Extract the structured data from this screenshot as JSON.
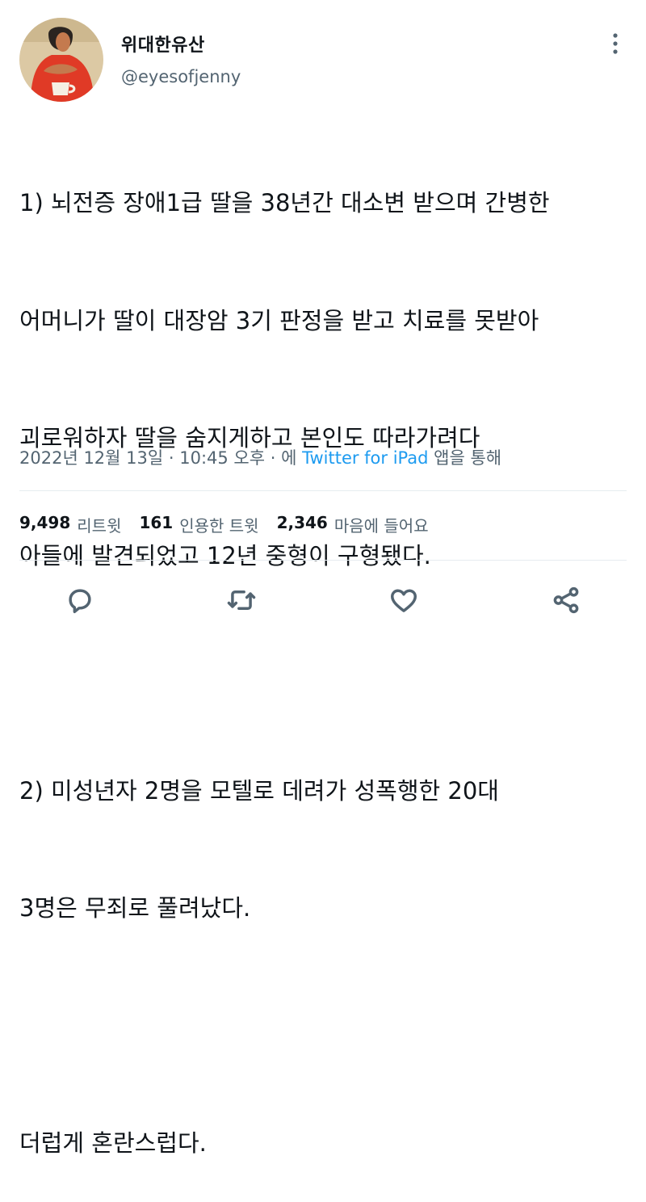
{
  "author": {
    "display_name": "위대한유산",
    "handle": "@eyesofjenny",
    "avatar_icon": "profile-avatar-painting"
  },
  "tweet": {
    "lines": [
      "1) 뇌전증 장애1급 딸을 38년간 대소변 받으며 간병한",
      "어머니가 딸이 대장암 3기 판정을 받고 치료를 못받아",
      "괴로워하자 딸을 숨지게하고 본인도 따라가려다",
      "아들에 발견되었고 12년 중형이 구형됐다.",
      "",
      "2) 미성년자 2명을 모텔로 데려가 성폭행한 20대",
      "3명은 무죄로 풀려났다.",
      "",
      "더럽게 혼란스럽다."
    ]
  },
  "meta": {
    "date": "2022년 12월 13일",
    "sep1": " · ",
    "time": "10:45 오후",
    "sep2": " · 에 ",
    "source": "Twitter for iPad",
    "suffix": " 앱을 통해"
  },
  "stats": {
    "retweets_count": "9,498",
    "retweets_label": "리트윗",
    "quotes_count": "161",
    "quotes_label": "인용한 트윗",
    "likes_count": "2,346",
    "likes_label": "마음에 들어요"
  },
  "actions": {
    "reply_icon": "reply-icon",
    "retweet_icon": "retweet-icon",
    "like_icon": "heart-icon",
    "share_icon": "share-icon",
    "icon_color": "#536471"
  },
  "colors": {
    "link": "#1d9bf0",
    "secondary_text": "#536471",
    "primary_text": "#0f1419",
    "divider": "#e6ecf0"
  }
}
